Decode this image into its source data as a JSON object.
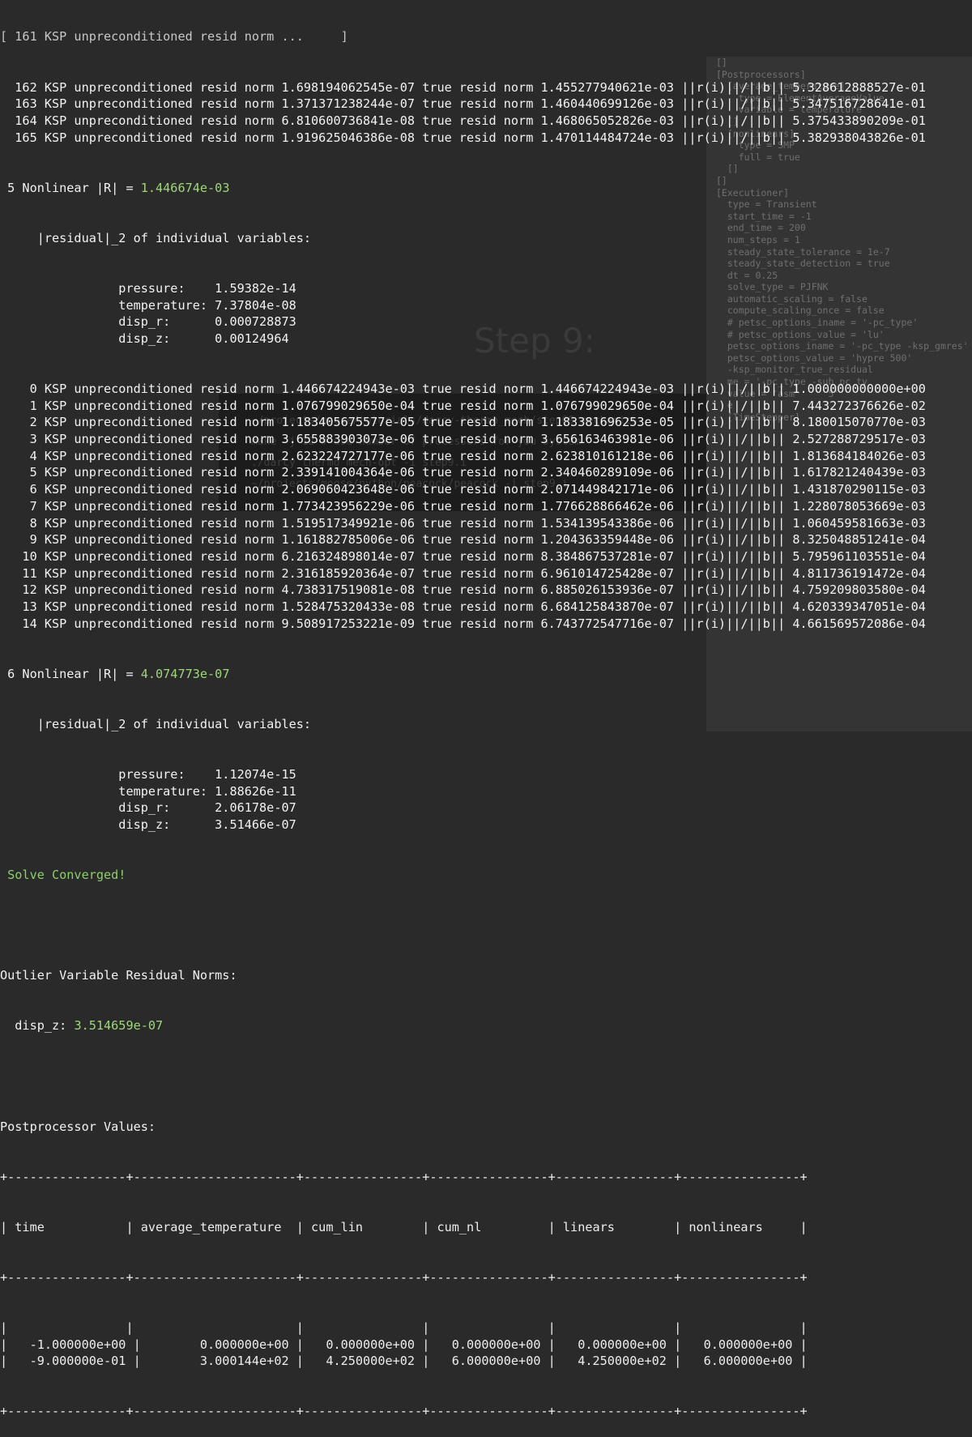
{
  "background_editor": {
    "lines": [
      "[]",
      "",
      "[Postprocessors]",
      "  [average_temperature]",
      "    type = ElementAverageValue",
      "    variable = temperature",
      "  []",
      "  [nonlinears]",
      "",
      "",
      "",
      "",
      "",
      "",
      "",
      "",
      "",
      "",
      "",
      "",
      "",
      "",
      "",
      "",
      "",
      "",
      "",
      "",
      "",
      "    type = SMP",
      "    full = true",
      "  []",
      "[]",
      "",
      "[Executioner]",
      "  type = Transient",
      "  start_time = -1",
      "  end_time = 200",
      "  num_steps = 1",
      "  steady_state_tolerance = 1e-7",
      "  steady_state_detection = true",
      "  dt = 0.25",
      "  solve_type = PJFNK",
      "  automatic_scaling = false",
      "  compute_scaling_once = false",
      "  # petsc_options_iname = '-pc_type'",
      "  # petsc_options_value = 'lu'",
      "  petsc_options_iname = '-pc_type -ksp_gmres'",
      "  petsc_options_value = 'hypre 500'",
      "  -ksp_monitor_true_residual",
      "  me = '-pc_type -sub_pc_ty",
      "  value = 'asm      5'",
      "  e",
      "  [TimeStepper]"
    ]
  },
  "background_shell": {
    "lines": [
      "~/projects/moose/tutorials/darcy-thermo_mech/step09_mechanics",
      "make -j 12 # use number of processors for you system",
      "./darcy_thermo_mech-opt -i step9.i",
      "~/projects/moose/python/peacock/peacock -i step9.i"
    ],
    "slide_title": "Step 9:"
  },
  "terminal": {
    "top_cut": "[ 161 KSP unpreconditioned resid norm ...     ]",
    "ksp_lines_a": [
      "  162 KSP unpreconditioned resid norm 1.698194062545e-07 true resid norm 1.455277940621e-03 ||r(i)||/||b|| 5.328612888527e-01",
      "  163 KSP unpreconditioned resid norm 1.371371238244e-07 true resid norm 1.460440699126e-03 ||r(i)||/||b|| 5.347516728641e-01",
      "  164 KSP unpreconditioned resid norm 6.810600736841e-08 true resid norm 1.468065052826e-03 ||r(i)||/||b|| 5.375433890209e-01",
      "  165 KSP unpreconditioned resid norm 1.919625046386e-08 true resid norm 1.470114484724e-03 ||r(i)||/||b|| 5.382938043826e-01"
    ],
    "nl5_prefix": " 5 Nonlinear |R| = ",
    "nl5_value": "1.446674e-03",
    "residual_header": "     |residual|_2 of individual variables:",
    "nl5_vars": [
      "                pressure:    1.59382e-14",
      "                temperature: 7.37804e-08",
      "                disp_r:      0.000728873",
      "                disp_z:      0.00124964"
    ],
    "ksp_lines_b": [
      "    0 KSP unpreconditioned resid norm 1.446674224943e-03 true resid norm 1.446674224943e-03 ||r(i)||/||b|| 1.000000000000e+00",
      "    1 KSP unpreconditioned resid norm 1.076799029650e-04 true resid norm 1.076799029650e-04 ||r(i)||/||b|| 7.443272376626e-02",
      "    2 KSP unpreconditioned resid norm 1.183405675577e-05 true resid norm 1.183381696253e-05 ||r(i)||/||b|| 8.180015070770e-03",
      "    3 KSP unpreconditioned resid norm 3.655883903073e-06 true resid norm 3.656163463981e-06 ||r(i)||/||b|| 2.527288729517e-03",
      "    4 KSP unpreconditioned resid norm 2.623224727177e-06 true resid norm 2.623810161218e-06 ||r(i)||/||b|| 1.813684184026e-03",
      "    5 KSP unpreconditioned resid norm 2.339141004364e-06 true resid norm 2.340460289109e-06 ||r(i)||/||b|| 1.617821240439e-03",
      "    6 KSP unpreconditioned resid norm 2.069060423648e-06 true resid norm 2.071449842171e-06 ||r(i)||/||b|| 1.431870290115e-03",
      "    7 KSP unpreconditioned resid norm 1.773423956229e-06 true resid norm 1.776628866462e-06 ||r(i)||/||b|| 1.228078053669e-03",
      "    8 KSP unpreconditioned resid norm 1.519517349921e-06 true resid norm 1.534139543386e-06 ||r(i)||/||b|| 1.060459581663e-03",
      "    9 KSP unpreconditioned resid norm 1.161882785006e-06 true resid norm 1.204363359448e-06 ||r(i)||/||b|| 8.325048851241e-04",
      "   10 KSP unpreconditioned resid norm 6.216324898014e-07 true resid norm 8.384867537281e-07 ||r(i)||/||b|| 5.795961103551e-04",
      "   11 KSP unpreconditioned resid norm 2.316185920364e-07 true resid norm 6.961014725428e-07 ||r(i)||/||b|| 4.811736191472e-04",
      "   12 KSP unpreconditioned resid norm 4.738317519081e-08 true resid norm 6.885026153936e-07 ||r(i)||/||b|| 4.759209803580e-04",
      "   13 KSP unpreconditioned resid norm 1.528475320433e-08 true resid norm 6.684125843870e-07 ||r(i)||/||b|| 4.620339347051e-04",
      "   14 KSP unpreconditioned resid norm 9.508917253221e-09 true resid norm 6.743772547716e-07 ||r(i)||/||b|| 4.661569572086e-04"
    ],
    "nl6_prefix": " 6 Nonlinear |R| = ",
    "nl6_value": "4.074773e-07",
    "nl6_vars": [
      "                pressure:    1.12074e-15",
      "                temperature: 1.88626e-11",
      "                disp_r:      2.06178e-07",
      "                disp_z:      3.51466e-07"
    ],
    "converged": " Solve Converged!",
    "outlier_title": "Outlier Variable Residual Norms:",
    "outlier_var": "  disp_z: ",
    "outlier_value": "3.514659e-07",
    "pp_title": "Postprocessor Values:",
    "table": {
      "border": "+----------------+----------------------+----------------+----------------+----------------+----------------+",
      "header": "| time           | average_temperature  | cum_lin        | cum_nl         | linears        | nonlinears     |",
      "rows": [
        "|   -1.000000e+00 |        0.000000e+00 |   0.000000e+00 |   0.000000e+00 |   0.000000e+00 |   0.000000e+00 |",
        "|   -9.000000e-01 |        3.000144e+02 |   4.250000e+02 |   6.000000e+00 |   4.250000e+02 |   6.000000e+00 |"
      ]
    }
  }
}
